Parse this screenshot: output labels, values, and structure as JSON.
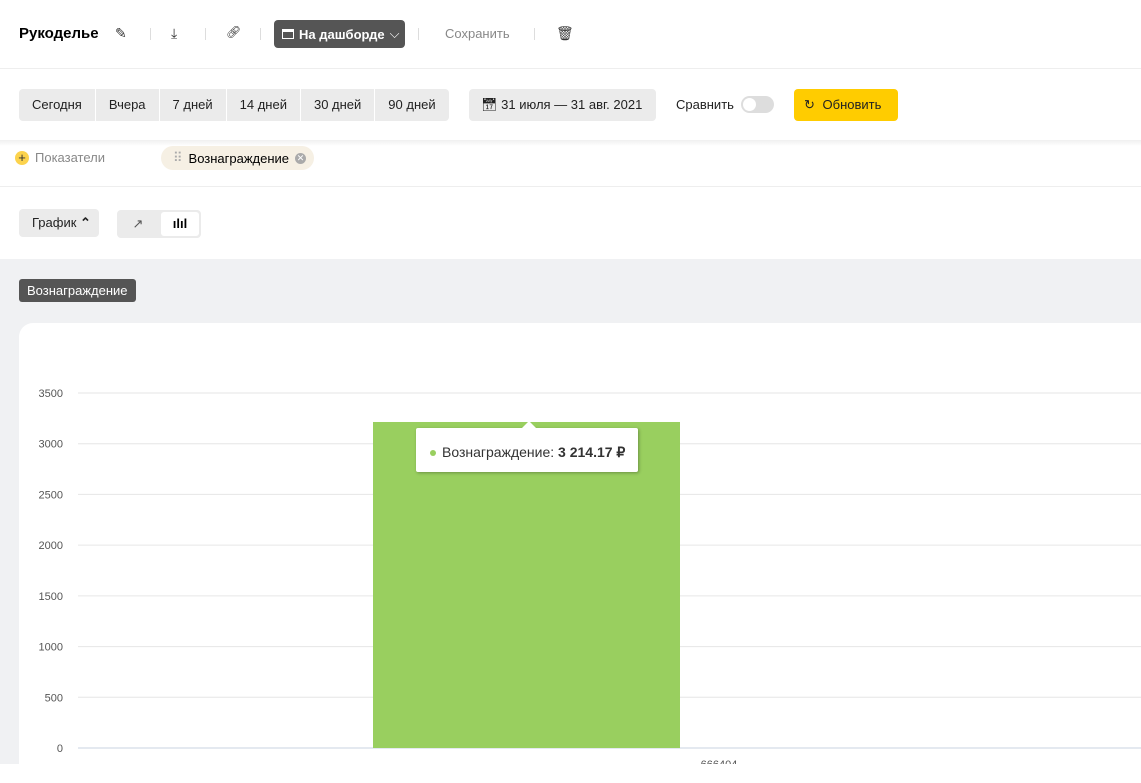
{
  "header": {
    "title": "Рукоделье",
    "dashboard_label": "На дашборде",
    "save_label": "Сохранить"
  },
  "toolbar": {
    "periods": [
      "Сегодня",
      "Вчера",
      "7 дней",
      "14 дней",
      "30 дней",
      "90 дней"
    ],
    "date_range": "31 июля — 31 авг. 2021",
    "compare_label": "Сравнить",
    "update_label": "Обновить"
  },
  "metrics": {
    "add_label": "Показатели",
    "chip_label": "Вознаграждение"
  },
  "view": {
    "graph_label": "График"
  },
  "chart_tag": "Вознаграждение",
  "tooltip": {
    "label": "Вознаграждение:",
    "value": "3 214.17 ₽"
  },
  "colors": {
    "accent": "#ffcc00",
    "bar": "#99cf5f"
  },
  "chart_data": {
    "type": "bar",
    "categories": [
      "666404"
    ],
    "series": [
      {
        "name": "Вознаграждение",
        "values": [
          3214.17
        ]
      }
    ],
    "yticks": [
      0,
      500,
      1000,
      1500,
      2000,
      2500,
      3000,
      3500
    ],
    "ylim": [
      0,
      3500
    ],
    "grid": true
  }
}
